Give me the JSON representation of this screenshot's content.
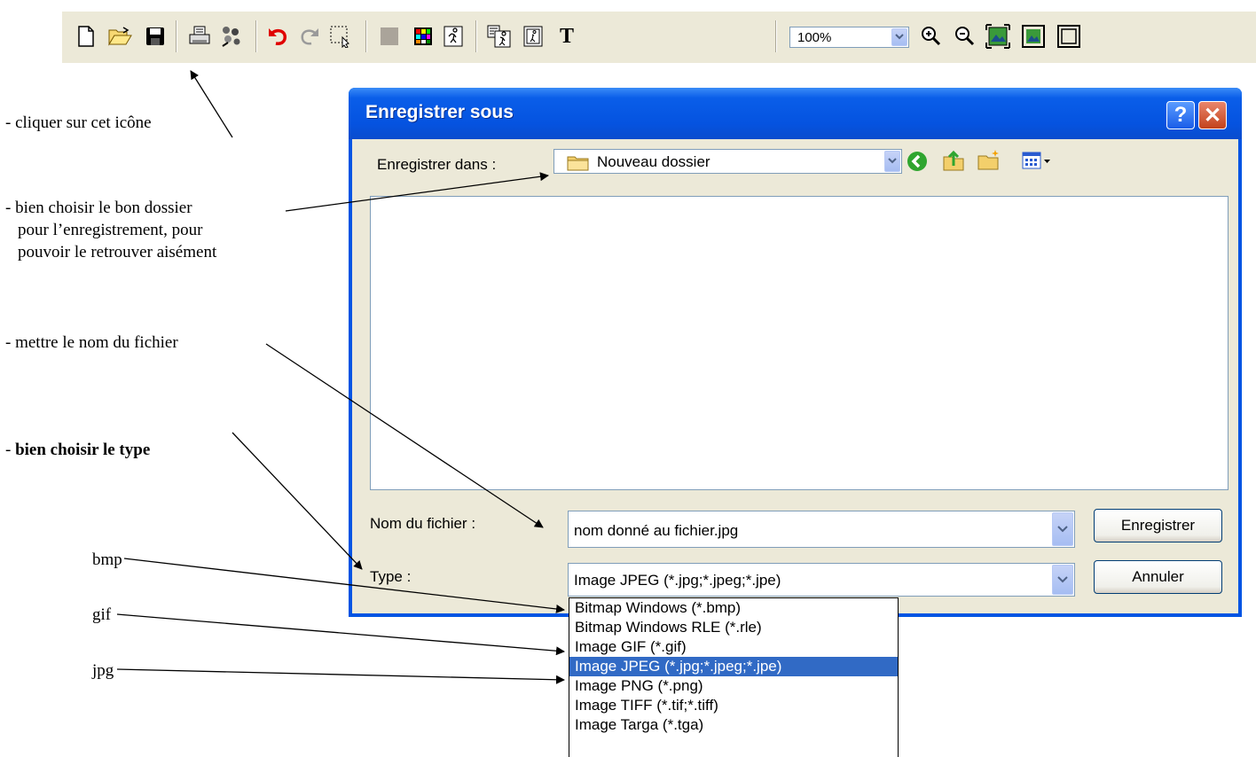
{
  "toolbar": {
    "zoom_value": "100%",
    "icons": [
      "new-file-icon",
      "open-folder-icon",
      "save-icon",
      "print-icon",
      "scanner-icon",
      "undo-icon",
      "redo-icon",
      "select-icon",
      "gray-color-icon",
      "palette-icon",
      "image-icon",
      "image-tools-icon",
      "frame-icon",
      "text-icon",
      "zoom-in-icon",
      "zoom-out-icon",
      "fit-icon",
      "fit-window-icon",
      "full-screen-icon"
    ]
  },
  "annotations": {
    "click_icon": "- cliquer sur cet icône",
    "folder_line1": "- bien choisir le bon dossier",
    "folder_line2": "pour l’enregistrement, pour",
    "folder_line3": "pouvoir le retrouver aisément",
    "filename": "- mettre le nom du fichier",
    "type_prefix": "- ",
    "type_bold": "bien choisir le type",
    "bmp": "bmp",
    "gif": "gif",
    "jpg": "jpg"
  },
  "dialog": {
    "title": "Enregistrer sous",
    "help_label": "?",
    "close_label": "✕",
    "save_in_label": "Enregistrer dans :",
    "save_in_value": "Nouveau dossier",
    "filename_label": "Nom du fichier :",
    "filename_value": "nom donné au fichier.jpg",
    "type_label": "Type :",
    "type_value": "Image JPEG (*.jpg;*.jpeg;*.jpe)",
    "save_button": "Enregistrer",
    "cancel_button": "Annuler"
  },
  "type_options": [
    "Bitmap Windows (*.bmp)",
    "Bitmap Windows RLE (*.rle)",
    "Image GIF (*.gif)",
    "Image JPEG (*.jpg;*.jpeg;*.jpe)",
    "Image PNG (*.png)",
    "Image TIFF (*.tif;*.tiff)",
    "Image Targa (*.tga)"
  ],
  "selected_option_index": 3,
  "colors": {
    "title_blue": "#0054e3",
    "selection_blue": "#316ac5",
    "face": "#ece9d8"
  }
}
